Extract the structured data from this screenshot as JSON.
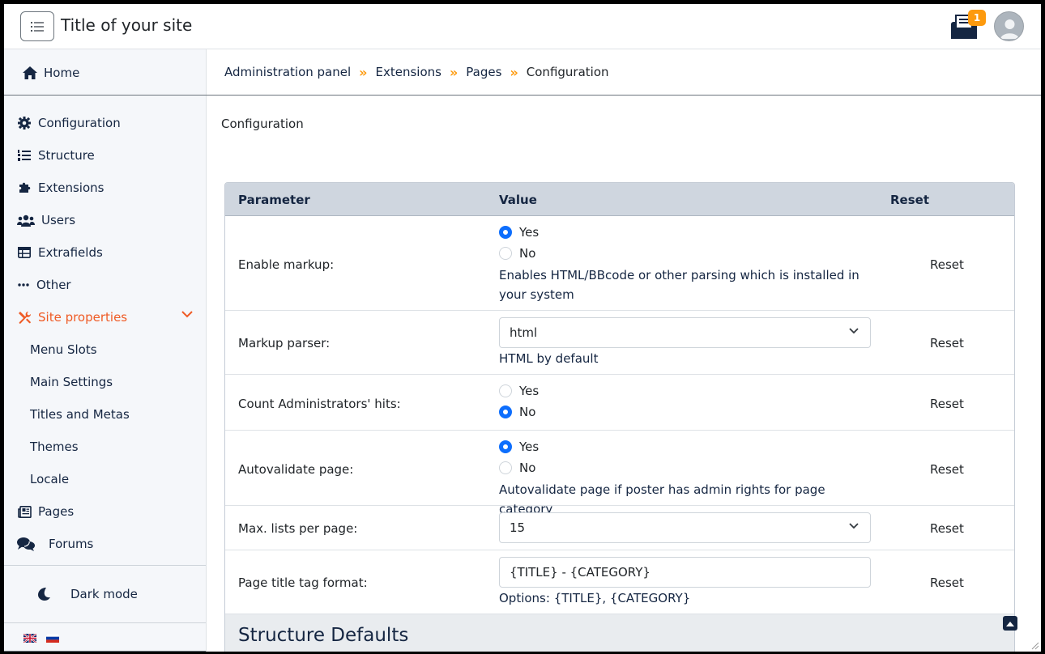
{
  "header": {
    "site_title": "Title of your site",
    "notifications_count": "1"
  },
  "sidebar": {
    "home": "Home",
    "items": [
      {
        "label": "Configuration",
        "icon": "gear-icon"
      },
      {
        "label": "Structure",
        "icon": "list-ordered-icon"
      },
      {
        "label": "Extensions",
        "icon": "puzzle-icon"
      },
      {
        "label": "Users",
        "icon": "users-icon"
      },
      {
        "label": "Extrafields",
        "icon": "table-icon"
      },
      {
        "label": "Other",
        "icon": "ellipsis-icon"
      },
      {
        "label": "Site properties",
        "icon": "tools-icon"
      }
    ],
    "sub_items": [
      "Menu Slots",
      "Main Settings",
      "Titles and Metas",
      "Themes",
      "Locale"
    ],
    "more_items": [
      {
        "label": "Pages",
        "icon": "newspaper-icon"
      },
      {
        "label": "Forums",
        "icon": "comments-icon"
      }
    ],
    "dark_mode": "Dark mode",
    "accent_color": "#ef5b25"
  },
  "breadcrumb": {
    "items": [
      "Administration panel",
      "Extensions",
      "Pages"
    ],
    "current": "Configuration",
    "separator": "»"
  },
  "page": {
    "heading": "Configuration"
  },
  "table": {
    "headers": {
      "parameter": "Parameter",
      "value": "Value",
      "reset": "Reset"
    },
    "reset_label": "Reset",
    "rows": {
      "enable_markup": {
        "label": "Enable markup:",
        "options": [
          "Yes",
          "No"
        ],
        "selected": "Yes",
        "hint": "Enables HTML/BBcode or other parsing which is installed in your system"
      },
      "markup_parser": {
        "label": "Markup parser:",
        "value": "html",
        "hint": "HTML by default"
      },
      "count_admin_hits": {
        "label": "Count Administrators' hits:",
        "options": [
          "Yes",
          "No"
        ],
        "selected": "No"
      },
      "autovalidate": {
        "label": "Autovalidate page:",
        "options": [
          "Yes",
          "No"
        ],
        "selected": "Yes",
        "hint": "Autovalidate page if poster has admin rights for page category"
      },
      "max_lists": {
        "label": "Max. lists per page:",
        "value": "15"
      },
      "title_format": {
        "label": "Page title tag format:",
        "value": "{TITLE} - {CATEGORY}",
        "hint": "Options: {TITLE}, {CATEGORY}"
      }
    },
    "section_title": "Structure Defaults"
  }
}
